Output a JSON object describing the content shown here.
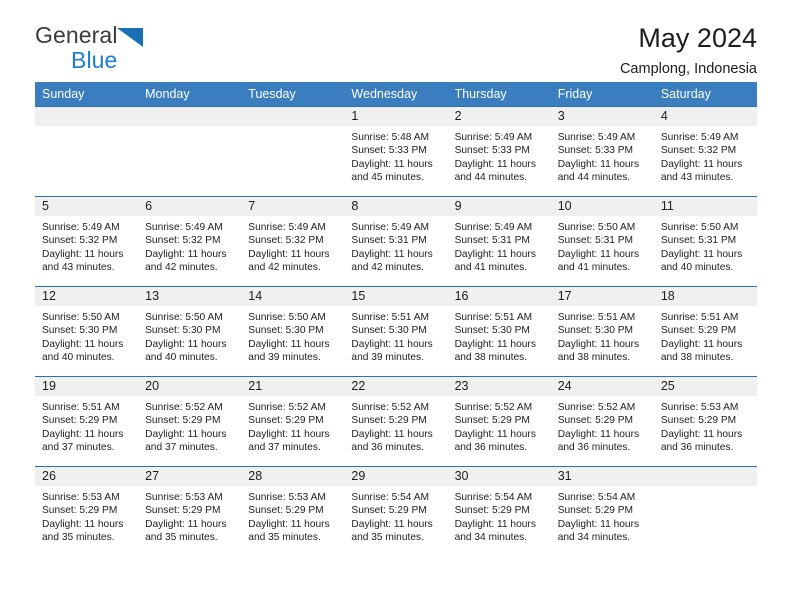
{
  "brand": {
    "name_part1": "General",
    "name_part2": "Blue",
    "triangle_color": "#1a6fb5",
    "text_color": "#3b3b3b",
    "blue_color": "#1a7fd4"
  },
  "header": {
    "title": "May 2024",
    "location": "Camplong, Indonesia"
  },
  "theme": {
    "header_bg": "#3a7ec0",
    "daynum_bg": "#f0f0f0",
    "grid_line": "#2f6fae"
  },
  "weekdays": [
    "Sunday",
    "Monday",
    "Tuesday",
    "Wednesday",
    "Thursday",
    "Friday",
    "Saturday"
  ],
  "labels": {
    "sunrise": "Sunrise:",
    "sunset": "Sunset:",
    "daylight": "Daylight:"
  },
  "weeks": [
    [
      {
        "day": "",
        "blank": true,
        "sunrise": "",
        "sunset": "",
        "daylight_line1": "",
        "daylight_line2": ""
      },
      {
        "day": "",
        "blank": true,
        "sunrise": "",
        "sunset": "",
        "daylight_line1": "",
        "daylight_line2": ""
      },
      {
        "day": "",
        "blank": true,
        "sunrise": "",
        "sunset": "",
        "daylight_line1": "",
        "daylight_line2": ""
      },
      {
        "day": "1",
        "blank": false,
        "sunrise": "Sunrise: 5:48 AM",
        "sunset": "Sunset: 5:33 PM",
        "daylight_line1": "Daylight: 11 hours",
        "daylight_line2": "and 45 minutes."
      },
      {
        "day": "2",
        "blank": false,
        "sunrise": "Sunrise: 5:49 AM",
        "sunset": "Sunset: 5:33 PM",
        "daylight_line1": "Daylight: 11 hours",
        "daylight_line2": "and 44 minutes."
      },
      {
        "day": "3",
        "blank": false,
        "sunrise": "Sunrise: 5:49 AM",
        "sunset": "Sunset: 5:33 PM",
        "daylight_line1": "Daylight: 11 hours",
        "daylight_line2": "and 44 minutes."
      },
      {
        "day": "4",
        "blank": false,
        "sunrise": "Sunrise: 5:49 AM",
        "sunset": "Sunset: 5:32 PM",
        "daylight_line1": "Daylight: 11 hours",
        "daylight_line2": "and 43 minutes."
      }
    ],
    [
      {
        "day": "5",
        "blank": false,
        "sunrise": "Sunrise: 5:49 AM",
        "sunset": "Sunset: 5:32 PM",
        "daylight_line1": "Daylight: 11 hours",
        "daylight_line2": "and 43 minutes."
      },
      {
        "day": "6",
        "blank": false,
        "sunrise": "Sunrise: 5:49 AM",
        "sunset": "Sunset: 5:32 PM",
        "daylight_line1": "Daylight: 11 hours",
        "daylight_line2": "and 42 minutes."
      },
      {
        "day": "7",
        "blank": false,
        "sunrise": "Sunrise: 5:49 AM",
        "sunset": "Sunset: 5:32 PM",
        "daylight_line1": "Daylight: 11 hours",
        "daylight_line2": "and 42 minutes."
      },
      {
        "day": "8",
        "blank": false,
        "sunrise": "Sunrise: 5:49 AM",
        "sunset": "Sunset: 5:31 PM",
        "daylight_line1": "Daylight: 11 hours",
        "daylight_line2": "and 42 minutes."
      },
      {
        "day": "9",
        "blank": false,
        "sunrise": "Sunrise: 5:49 AM",
        "sunset": "Sunset: 5:31 PM",
        "daylight_line1": "Daylight: 11 hours",
        "daylight_line2": "and 41 minutes."
      },
      {
        "day": "10",
        "blank": false,
        "sunrise": "Sunrise: 5:50 AM",
        "sunset": "Sunset: 5:31 PM",
        "daylight_line1": "Daylight: 11 hours",
        "daylight_line2": "and 41 minutes."
      },
      {
        "day": "11",
        "blank": false,
        "sunrise": "Sunrise: 5:50 AM",
        "sunset": "Sunset: 5:31 PM",
        "daylight_line1": "Daylight: 11 hours",
        "daylight_line2": "and 40 minutes."
      }
    ],
    [
      {
        "day": "12",
        "blank": false,
        "sunrise": "Sunrise: 5:50 AM",
        "sunset": "Sunset: 5:30 PM",
        "daylight_line1": "Daylight: 11 hours",
        "daylight_line2": "and 40 minutes."
      },
      {
        "day": "13",
        "blank": false,
        "sunrise": "Sunrise: 5:50 AM",
        "sunset": "Sunset: 5:30 PM",
        "daylight_line1": "Daylight: 11 hours",
        "daylight_line2": "and 40 minutes."
      },
      {
        "day": "14",
        "blank": false,
        "sunrise": "Sunrise: 5:50 AM",
        "sunset": "Sunset: 5:30 PM",
        "daylight_line1": "Daylight: 11 hours",
        "daylight_line2": "and 39 minutes."
      },
      {
        "day": "15",
        "blank": false,
        "sunrise": "Sunrise: 5:51 AM",
        "sunset": "Sunset: 5:30 PM",
        "daylight_line1": "Daylight: 11 hours",
        "daylight_line2": "and 39 minutes."
      },
      {
        "day": "16",
        "blank": false,
        "sunrise": "Sunrise: 5:51 AM",
        "sunset": "Sunset: 5:30 PM",
        "daylight_line1": "Daylight: 11 hours",
        "daylight_line2": "and 38 minutes."
      },
      {
        "day": "17",
        "blank": false,
        "sunrise": "Sunrise: 5:51 AM",
        "sunset": "Sunset: 5:30 PM",
        "daylight_line1": "Daylight: 11 hours",
        "daylight_line2": "and 38 minutes."
      },
      {
        "day": "18",
        "blank": false,
        "sunrise": "Sunrise: 5:51 AM",
        "sunset": "Sunset: 5:29 PM",
        "daylight_line1": "Daylight: 11 hours",
        "daylight_line2": "and 38 minutes."
      }
    ],
    [
      {
        "day": "19",
        "blank": false,
        "sunrise": "Sunrise: 5:51 AM",
        "sunset": "Sunset: 5:29 PM",
        "daylight_line1": "Daylight: 11 hours",
        "daylight_line2": "and 37 minutes."
      },
      {
        "day": "20",
        "blank": false,
        "sunrise": "Sunrise: 5:52 AM",
        "sunset": "Sunset: 5:29 PM",
        "daylight_line1": "Daylight: 11 hours",
        "daylight_line2": "and 37 minutes."
      },
      {
        "day": "21",
        "blank": false,
        "sunrise": "Sunrise: 5:52 AM",
        "sunset": "Sunset: 5:29 PM",
        "daylight_line1": "Daylight: 11 hours",
        "daylight_line2": "and 37 minutes."
      },
      {
        "day": "22",
        "blank": false,
        "sunrise": "Sunrise: 5:52 AM",
        "sunset": "Sunset: 5:29 PM",
        "daylight_line1": "Daylight: 11 hours",
        "daylight_line2": "and 36 minutes."
      },
      {
        "day": "23",
        "blank": false,
        "sunrise": "Sunrise: 5:52 AM",
        "sunset": "Sunset: 5:29 PM",
        "daylight_line1": "Daylight: 11 hours",
        "daylight_line2": "and 36 minutes."
      },
      {
        "day": "24",
        "blank": false,
        "sunrise": "Sunrise: 5:52 AM",
        "sunset": "Sunset: 5:29 PM",
        "daylight_line1": "Daylight: 11 hours",
        "daylight_line2": "and 36 minutes."
      },
      {
        "day": "25",
        "blank": false,
        "sunrise": "Sunrise: 5:53 AM",
        "sunset": "Sunset: 5:29 PM",
        "daylight_line1": "Daylight: 11 hours",
        "daylight_line2": "and 36 minutes."
      }
    ],
    [
      {
        "day": "26",
        "blank": false,
        "sunrise": "Sunrise: 5:53 AM",
        "sunset": "Sunset: 5:29 PM",
        "daylight_line1": "Daylight: 11 hours",
        "daylight_line2": "and 35 minutes."
      },
      {
        "day": "27",
        "blank": false,
        "sunrise": "Sunrise: 5:53 AM",
        "sunset": "Sunset: 5:29 PM",
        "daylight_line1": "Daylight: 11 hours",
        "daylight_line2": "and 35 minutes."
      },
      {
        "day": "28",
        "blank": false,
        "sunrise": "Sunrise: 5:53 AM",
        "sunset": "Sunset: 5:29 PM",
        "daylight_line1": "Daylight: 11 hours",
        "daylight_line2": "and 35 minutes."
      },
      {
        "day": "29",
        "blank": false,
        "sunrise": "Sunrise: 5:54 AM",
        "sunset": "Sunset: 5:29 PM",
        "daylight_line1": "Daylight: 11 hours",
        "daylight_line2": "and 35 minutes."
      },
      {
        "day": "30",
        "blank": false,
        "sunrise": "Sunrise: 5:54 AM",
        "sunset": "Sunset: 5:29 PM",
        "daylight_line1": "Daylight: 11 hours",
        "daylight_line2": "and 34 minutes."
      },
      {
        "day": "31",
        "blank": false,
        "sunrise": "Sunrise: 5:54 AM",
        "sunset": "Sunset: 5:29 PM",
        "daylight_line1": "Daylight: 11 hours",
        "daylight_line2": "and 34 minutes."
      },
      {
        "day": "",
        "blank": true,
        "sunrise": "",
        "sunset": "",
        "daylight_line1": "",
        "daylight_line2": ""
      }
    ]
  ]
}
